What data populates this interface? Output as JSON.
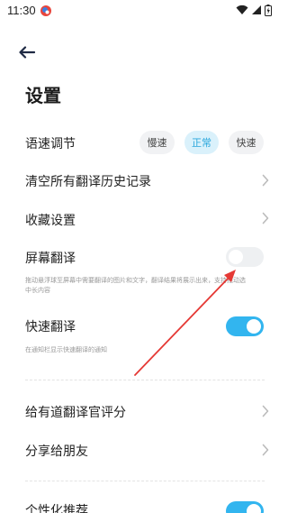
{
  "status_bar": {
    "time": "11:30"
  },
  "header": {
    "title": "设置"
  },
  "settings": {
    "speed": {
      "label": "语速调节",
      "options": [
        "慢速",
        "正常",
        "快速"
      ],
      "selected": "正常"
    },
    "clear_history": {
      "label": "清空所有翻译历史记录"
    },
    "favorites": {
      "label": "收藏设置"
    },
    "screen_translate": {
      "label": "屏幕翻译",
      "description": "拖动悬浮球至屏幕中需要翻译的图片和文字，翻译结果将展示出来，支持拖动选中长内容",
      "enabled": false
    },
    "quick_translate": {
      "label": "快速翻译",
      "description": "在通知栏显示快速翻译的通知",
      "enabled": true
    },
    "rate": {
      "label": "给有道翻译官评分"
    },
    "share": {
      "label": "分享给朋友"
    },
    "personalized_rec": {
      "label": "个性化推荐",
      "enabled": true
    }
  },
  "colors": {
    "accent": "#32b5ef",
    "annotation_arrow": "#e53935"
  }
}
